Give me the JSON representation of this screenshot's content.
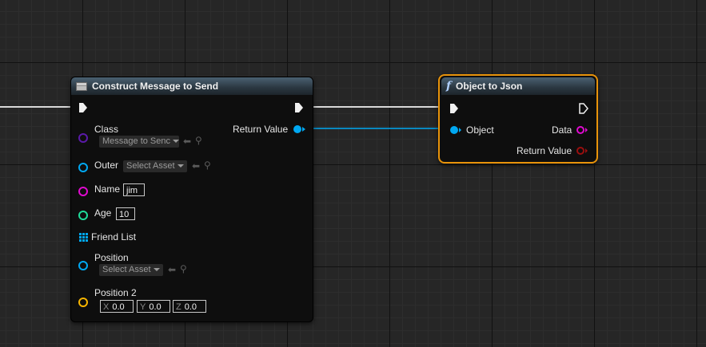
{
  "nodes": {
    "construct": {
      "title": "Construct Message to Send",
      "pins": {
        "return_value": "Return Value",
        "class_label": "Class",
        "class_value": "Message to Senc",
        "outer_label": "Outer",
        "outer_value": "Select Asset",
        "name_label": "Name",
        "name_value": "jim",
        "age_label": "Age",
        "age_value": "10",
        "friend_list_label": "Friend List",
        "position_label": "Position",
        "position_value": "Select Asset",
        "position2_label": "Position 2",
        "x_label": "X",
        "x_value": "0.0",
        "y_label": "Y",
        "y_value": "0.0",
        "z_label": "Z",
        "z_value": "0.0"
      }
    },
    "object_to_json": {
      "title": "Object to Json",
      "pins": {
        "object": "Object",
        "data": "Data",
        "return_value": "Return Value"
      }
    }
  },
  "colors": {
    "object_pin": "#00a8f2",
    "class_pin": "#5a1aa8",
    "string_pin": "#e00ad0",
    "int_pin": "#1fdb9a",
    "struct_pin": "#f7b500",
    "return_pin": "#9a0f0f",
    "exec_wire": "#d8d8d8",
    "selection": "#e8930a"
  },
  "icons": {
    "construct_header": "struct-icon",
    "function_header": "function-icon",
    "use_selected": "left-arrow-icon",
    "browse": "magnifier-icon",
    "array": "array-grid-icon"
  }
}
